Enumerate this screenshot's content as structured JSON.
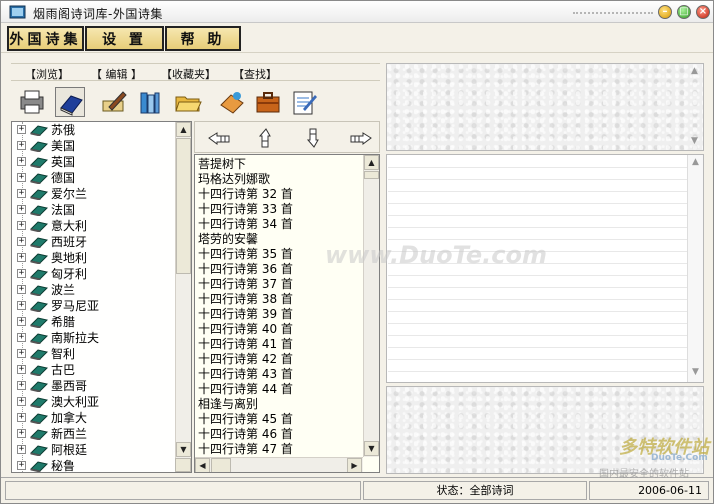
{
  "window": {
    "title": "烟雨阁诗词库-外国诗集"
  },
  "menu": [
    "外国诗集",
    "设 置",
    "帮 助"
  ],
  "subtabs": [
    "【浏览】",
    "【 编辑 】",
    "【收藏夹】",
    "【查找】"
  ],
  "toolbar_icons": [
    "printer-icon",
    "book-icon",
    "edit-pen-icon",
    "books-icon",
    "open-folder-icon",
    "paint-icon",
    "briefcase-icon",
    "notebook-icon"
  ],
  "countries": [
    "苏俄",
    "美国",
    "英国",
    "德国",
    "爱尔兰",
    "法国",
    "意大利",
    "西班牙",
    "奥地利",
    "匈牙利",
    "波兰",
    "罗马尼亚",
    "希腊",
    "南斯拉夫",
    "智利",
    "古巴",
    "墨西哥",
    "澳大利亚",
    "加拿大",
    "新西兰",
    "阿根廷",
    "秘鲁"
  ],
  "poems": [
    "菩提树下",
    "玛格达列娜歌",
    "十四行诗第 32 首",
    "十四行诗第 33 首",
    "十四行诗第 34 首",
    "塔劳的安馨",
    "十四行诗第 35 首",
    "十四行诗第 36 首",
    "十四行诗第 37 首",
    "十四行诗第 38 首",
    "十四行诗第 39 首",
    "十四行诗第 40 首",
    "十四行诗第 41 首",
    "十四行诗第 42 首",
    "十四行诗第 43 首",
    "十四行诗第 44 首",
    "相逢与离别",
    "十四行诗第 45 首",
    "十四行诗第 46 首",
    "十四行诗第 47 首"
  ],
  "status": {
    "label": "状态：全部诗词",
    "date": "2006-06-11"
  },
  "watermark": {
    "site": "www.DuoTe.com",
    "logo": "多特软件站",
    "logo_sub": "DuoTe.Com",
    "slogan": "国内最安全的软件站"
  },
  "colors": {
    "menu_gold": "#e7cd78",
    "panel_bg": "#f4f1e8",
    "book_green": "#1f7a6a"
  }
}
